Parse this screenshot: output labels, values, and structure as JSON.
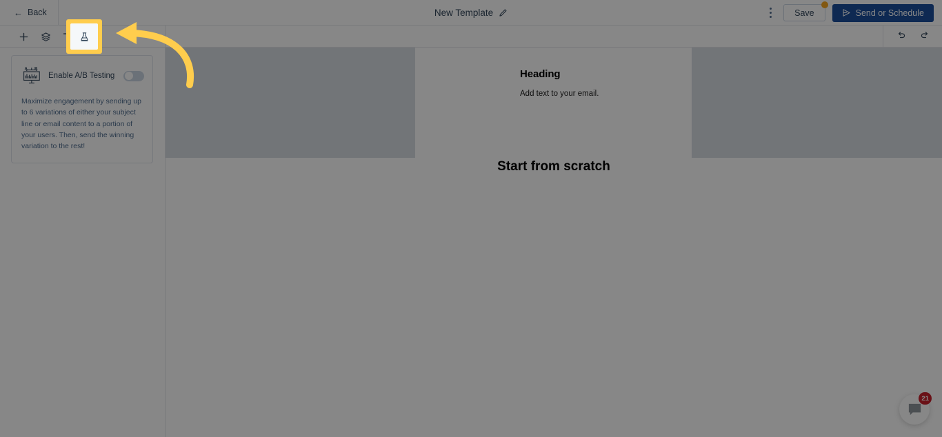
{
  "app": {
    "accent_blue": "#1b4f9c",
    "highlight_yellow": "#ffcd4d",
    "badge_orange": "#f5a623",
    "badge_red": "#c8202d",
    "canvas_placeholder": "#d8dde3"
  },
  "topbar": {
    "back_label": "Back",
    "title": "New Template",
    "edit_icon": "pencil-icon",
    "menu_icon": "kebab-menu-icon",
    "save_label": "Save",
    "save_badge": "unsaved-changes-dot",
    "send_label": "Send or Schedule",
    "send_icon": "paper-plane-icon"
  },
  "toolbar": {
    "tools": [
      {
        "name": "add-block-button",
        "icon": "plus-icon",
        "active": false
      },
      {
        "name": "layers-button",
        "icon": "layers-icon",
        "active": false
      },
      {
        "name": "filter-button",
        "icon": "filter-icon",
        "active": false
      },
      {
        "name": "ab-testing-button",
        "icon": "flask-icon",
        "active": true
      }
    ],
    "history": [
      {
        "name": "undo-button",
        "icon": "undo-icon"
      },
      {
        "name": "redo-button",
        "icon": "redo-icon"
      }
    ]
  },
  "ab_panel": {
    "icon": "ab-test-chart-icon",
    "icon_label_a": "A",
    "icon_label_b": "B",
    "toggle_label": "Enable A/B Testing",
    "toggle_state": "off",
    "description": "Maximize engagement by sending up to 6 variations of either your subject line or email content to a portion of your users. Then, send the winning variation to the rest!"
  },
  "canvas": {
    "heading": "Heading",
    "subtext": "Add text to your email.",
    "scratch_label": "Start from scratch"
  },
  "chat": {
    "icon": "chat-bubble-icon",
    "unread_count": "21"
  }
}
